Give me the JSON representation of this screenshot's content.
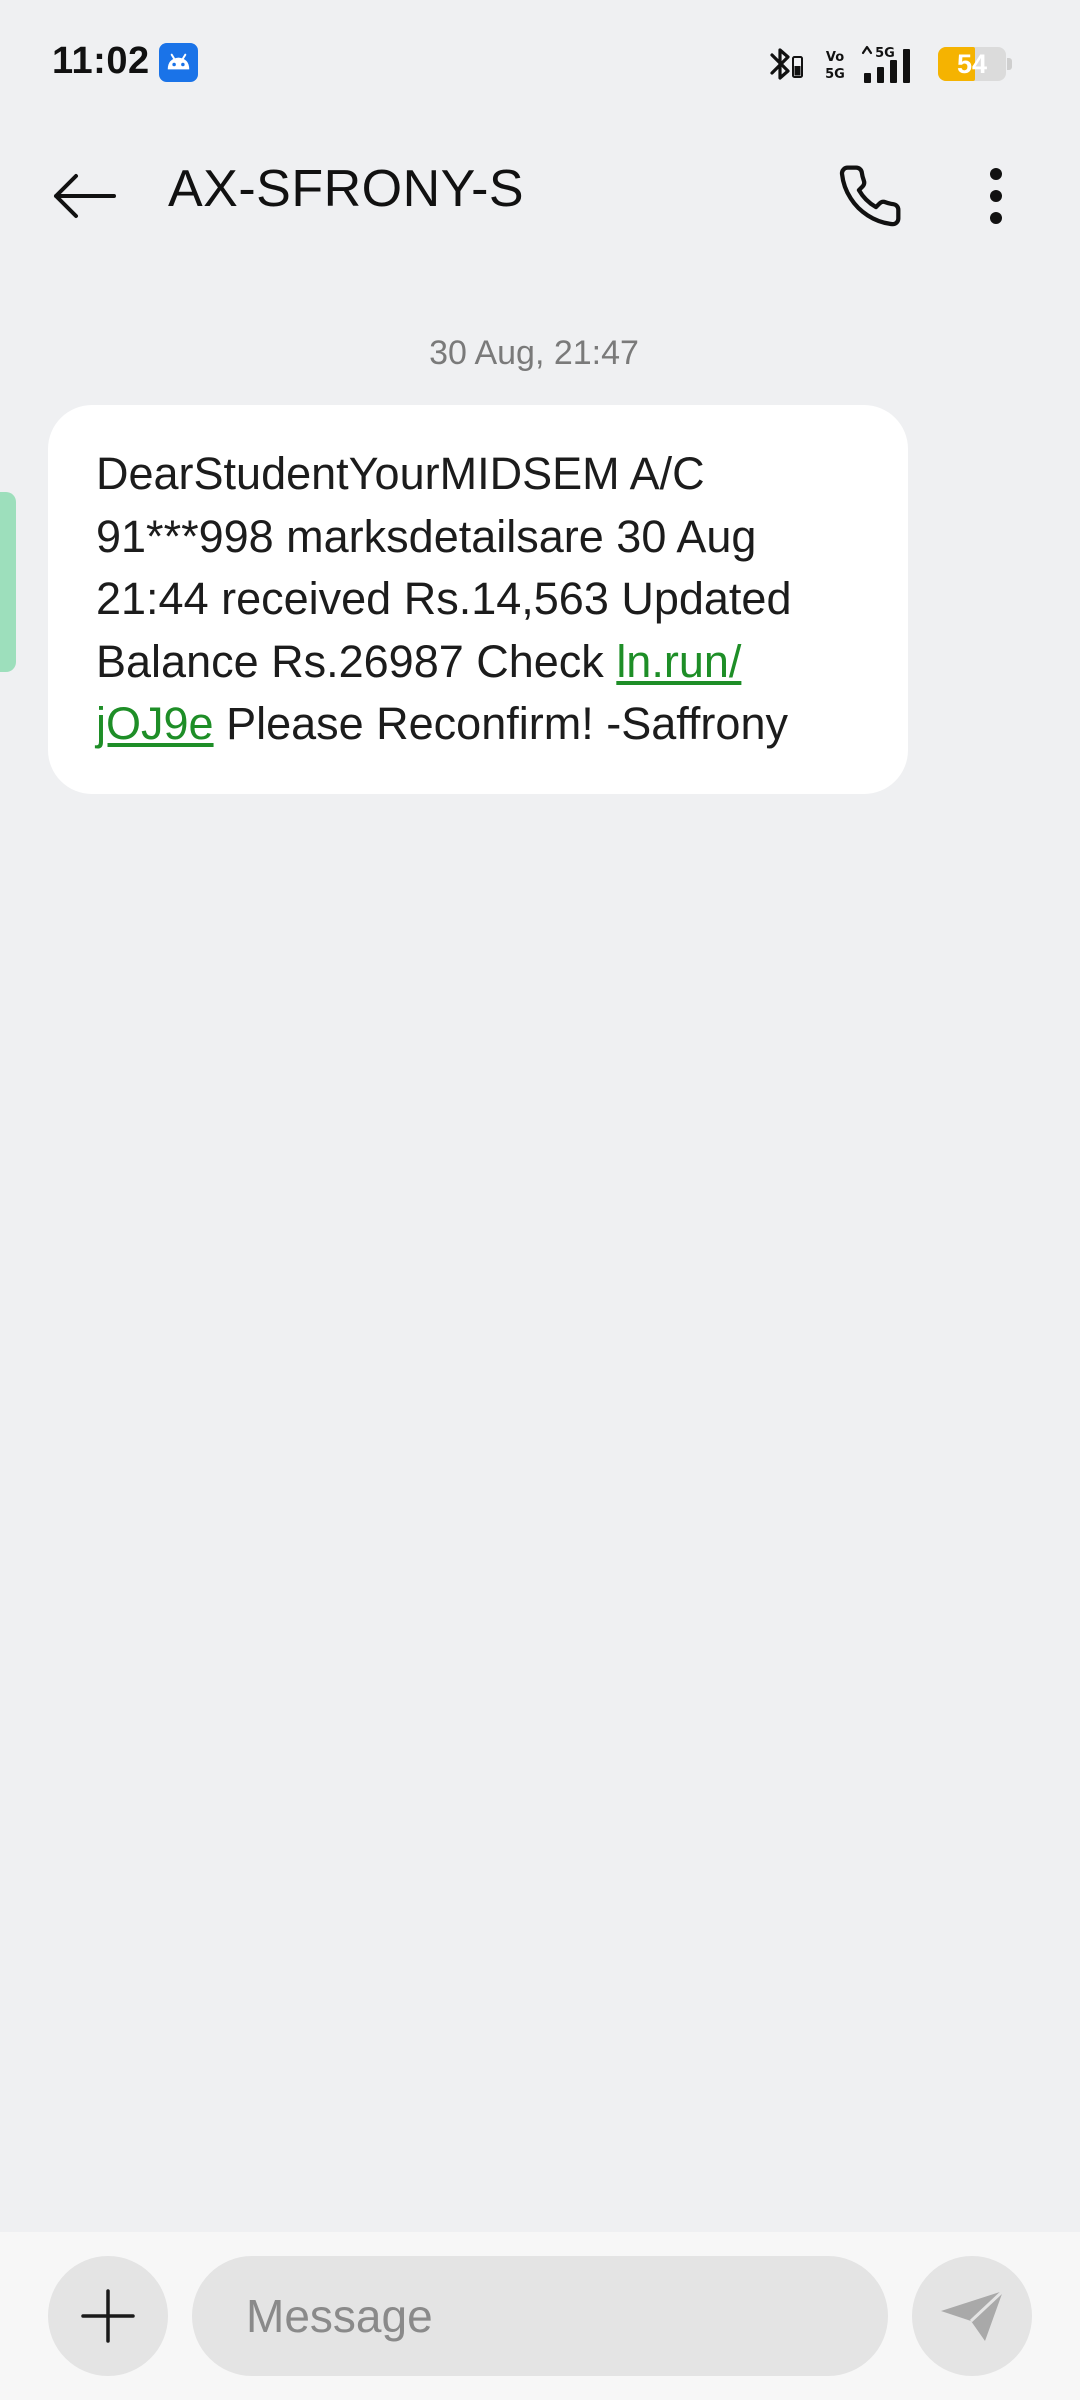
{
  "status_bar": {
    "time": "11:02",
    "battery_level": "54",
    "network": "5G",
    "app_icon": "android-robot-icon",
    "icons": [
      "bluetooth-icon",
      "volte-icon",
      "signal-icon",
      "battery-icon"
    ]
  },
  "header": {
    "contact_name": "AX-SFRONY-S",
    "back_icon": "arrow-left-icon",
    "call_icon": "phone-icon",
    "more_icon": "more-vertical-icon"
  },
  "conversation": {
    "timestamp": "30 Aug, 21:47",
    "message": {
      "line1": "DearStudentYourMIDSEM A/C",
      "line2": "91***998 marksdetailsare 30 Aug",
      "line3": "21:44 received Rs.14,563 Updated",
      "line4_text": "Balance Rs.26987 Check ",
      "link_part1": "ln.run/",
      "link_part2": "jOJ9e",
      "line5_text": " Please Reconfirm! -Saffrony"
    }
  },
  "composer": {
    "placeholder": "Message",
    "value": "",
    "attach_icon": "plus-icon",
    "send_icon": "send-icon"
  },
  "colors": {
    "background": "#eff0f2",
    "bubble": "#ffffff",
    "link": "#1e8e27",
    "battery": "#f5b301",
    "status_app_icon": "#1a73e8"
  }
}
